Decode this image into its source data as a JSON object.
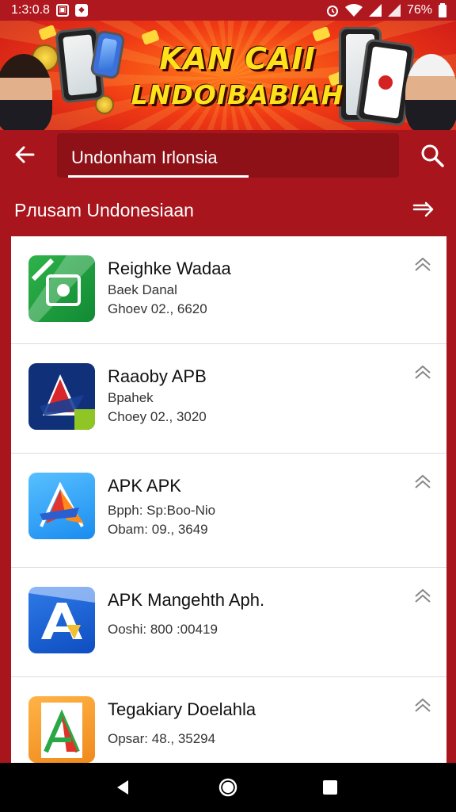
{
  "status_bar": {
    "time": "1:3:0.8",
    "battery": "76%",
    "icons": [
      "image-icon",
      "notification-icon",
      "alarm-icon",
      "wifi-icon",
      "signal-icon",
      "battery-icon"
    ]
  },
  "banner": {
    "title_line1": "KAN CAII",
    "title_line2": "LNDOIBABIAH"
  },
  "app_bar": {
    "search_value": "Undonham Irlonsia",
    "back_icon": "arrow-left-icon",
    "search_icon": "search-icon"
  },
  "section": {
    "title": "Pлusam Undonesiaan",
    "arrow_icon": "arrow-right-icon"
  },
  "apps": [
    {
      "name": "Reighke Wadaa",
      "line1": "Baek Danal",
      "line2": "Ghoev 02., 6620",
      "icon": "green-flag-icon"
    },
    {
      "name": "Raaoby APB",
      "line1": "Bpahek",
      "line2": "Choey 02., 3020",
      "icon": "red-blue-a-icon"
    },
    {
      "name": "APK APK",
      "line1": "Bpph: Sp:Boo-Nio",
      "line2": "Obam: 09., 3649",
      "icon": "blue-a-icon"
    },
    {
      "name": "APK Mangehth Aph.",
      "line1": "Ooshi: 800 :00419",
      "line2": "",
      "icon": "dark-blue-a-icon"
    },
    {
      "name": "Tegakiary Doelahla",
      "line1": "Opsar: 48., 35294",
      "line2": "",
      "icon": "orange-a-icon"
    }
  ],
  "nav": {
    "back": "nav-back-icon",
    "home": "nav-home-icon",
    "recents": "nav-recents-icon"
  },
  "colors": {
    "primary": "#a8151c",
    "primary_dark": "#8e1117",
    "banner_text": "#ffe21a"
  }
}
